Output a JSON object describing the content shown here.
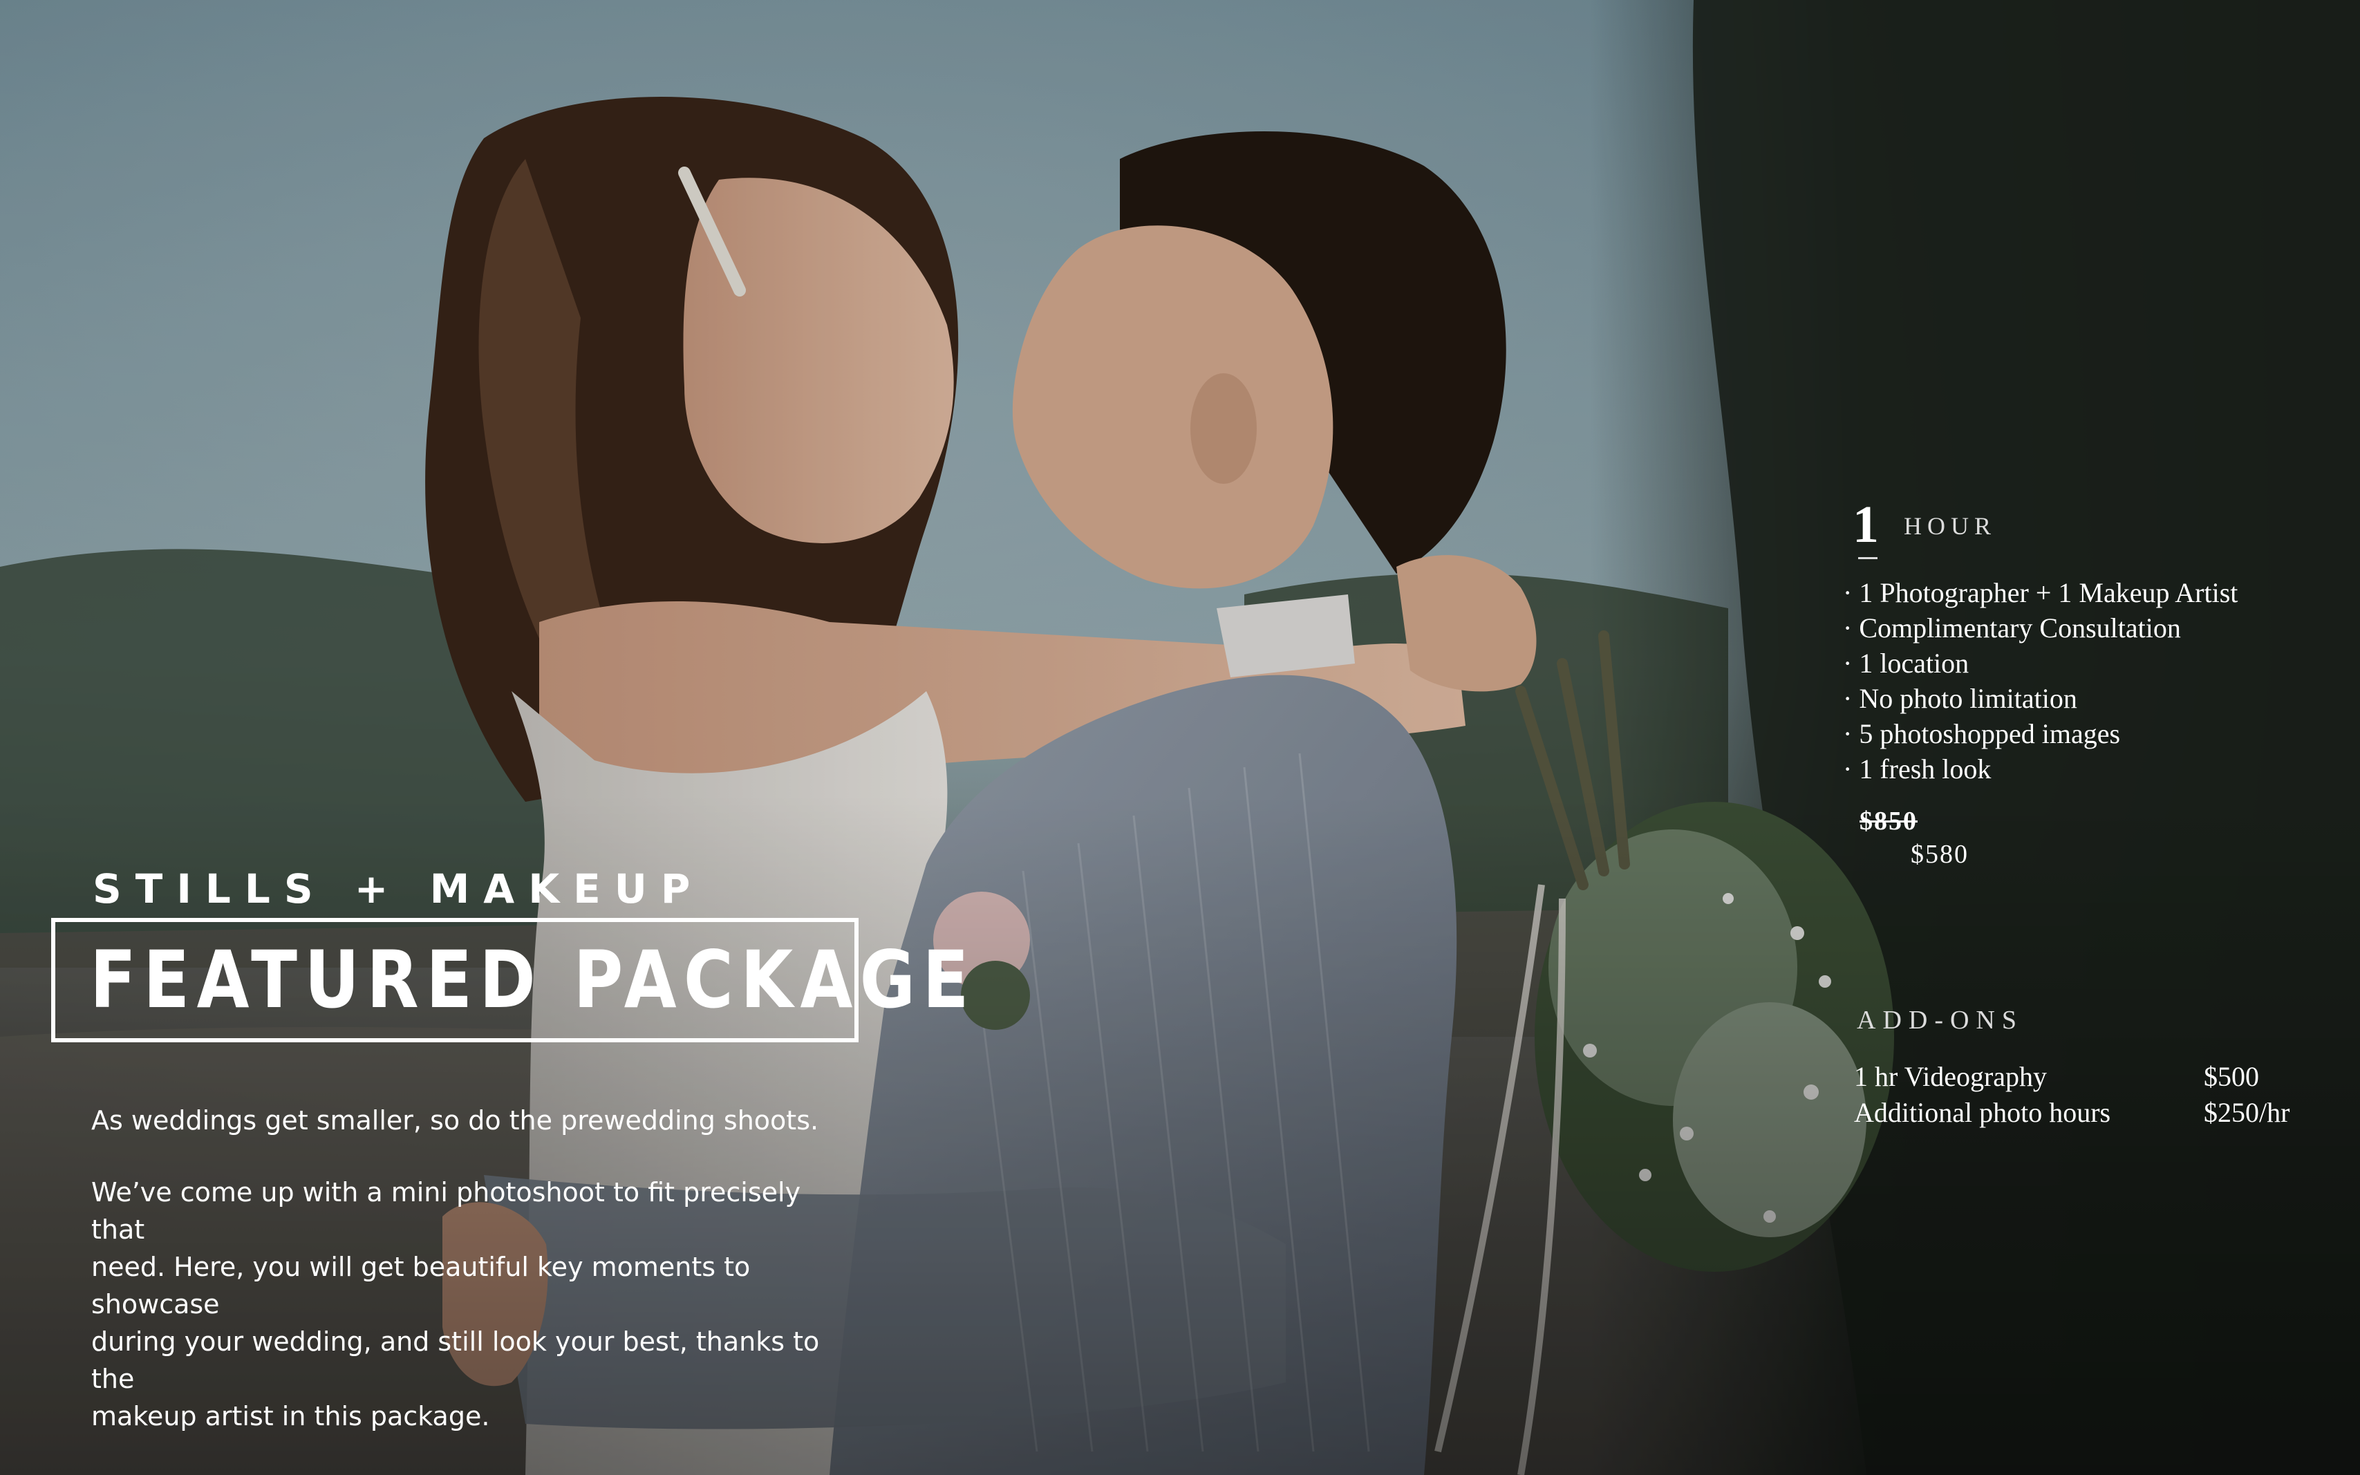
{
  "photo": {
    "description_icon": "couple-embrace-photo",
    "colors": {
      "sky": "#7d97a2",
      "foliage": "#2a3028",
      "dress": "#d8d5d0",
      "suit": "#8a95a3",
      "hair": "#2b1d17"
    }
  },
  "intro": {
    "subtitle": "STILLS + MAKEUP",
    "title": "FEATURED PACKAGE",
    "paragraph1": "As weddings get smaller, so do the prewedding shoots.",
    "paragraph2_lines": [
      "We’ve come up with a mini photoshoot to fit precisely that",
      "need. Here, you will get beautiful key moments to showcase",
      "during your wedding, and still look your best, thanks to the",
      "makeup artist in this package."
    ]
  },
  "package": {
    "duration_number": "1",
    "duration_unit": "HOUR",
    "features": [
      "· 1 Photographer + 1 Makeup Artist",
      "· Complimentary Consultation",
      "· 1 location",
      "· No photo limitation",
      "· 5 photoshopped images",
      "· 1 fresh look"
    ],
    "original_price": "$850",
    "price": "$580"
  },
  "addons": {
    "title": "ADD-ONS",
    "items": [
      {
        "name": "1 hr Videography",
        "price": "$500"
      },
      {
        "name": "Additional photo hours",
        "price": "$250/hr"
      }
    ]
  }
}
